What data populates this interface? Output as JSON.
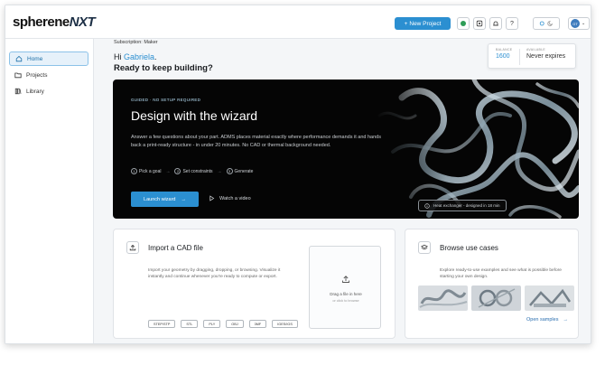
{
  "app": {
    "logo_main": "spherene",
    "logo_accent": "NXT"
  },
  "topbar": {
    "new_project_label": "New Project",
    "icons": [
      "status-dot-icon",
      "puzzle-icon",
      "bell-icon",
      "help-icon",
      "theme-toggle-icon",
      "avatar-icon"
    ],
    "avatar_initials": "GT"
  },
  "sidebar": {
    "items": [
      {
        "label": "Home",
        "icon": "home-icon",
        "active": true
      },
      {
        "label": "Projects",
        "icon": "folder-icon",
        "active": false
      },
      {
        "label": "Library",
        "icon": "library-icon",
        "active": false
      }
    ]
  },
  "header": {
    "subscription": "Subscription: Maker",
    "greeting_prefix": "Hi",
    "user_name": "Gabriela",
    "greeting_suffix": ".",
    "tagline": "Ready to keep building?"
  },
  "balance": {
    "balance_label": "BALANCE",
    "balance_value": "1600",
    "available_label": "AVAILABLE",
    "available_value": "Never expires"
  },
  "wizard": {
    "tag": "GUIDED · NO SETUP REQUIRED",
    "title": "Design with the wizard",
    "description": "Answer a few questions about your part. ADMS places material exactly where performance demands it and hands back a print-ready structure - in under 20 minutes. No CAD or thermal background needed.",
    "steps": [
      {
        "num": "1",
        "label": "Pick a goal"
      },
      {
        "num": "2",
        "label": "Set constraints"
      },
      {
        "num": "3",
        "label": "Generate"
      }
    ],
    "launch_label": "Launch wizard",
    "watch_label": "Watch a video",
    "caption": "Heat exchanger - designed in 18 min"
  },
  "import_card": {
    "title": "Import a CAD file",
    "description": "Import your geometry by dragging, dropping, or browsing. Visualize it instantly and continue whenever you're ready to compute or export.",
    "formats": [
      "STEP/STP",
      "STL",
      "PLY",
      "OBJ",
      "3MF",
      "IGES/IGS"
    ],
    "drop_text": "Drag a file in here",
    "drop_sub": "or click to browse"
  },
  "browse_card": {
    "title": "Browse use cases",
    "description": "Explore ready-to-use examples and see what is possible before starting your own design.",
    "open_label": "Open samples"
  },
  "colors": {
    "accent": "#2b8fd1",
    "wizard_bg": "#050505"
  }
}
